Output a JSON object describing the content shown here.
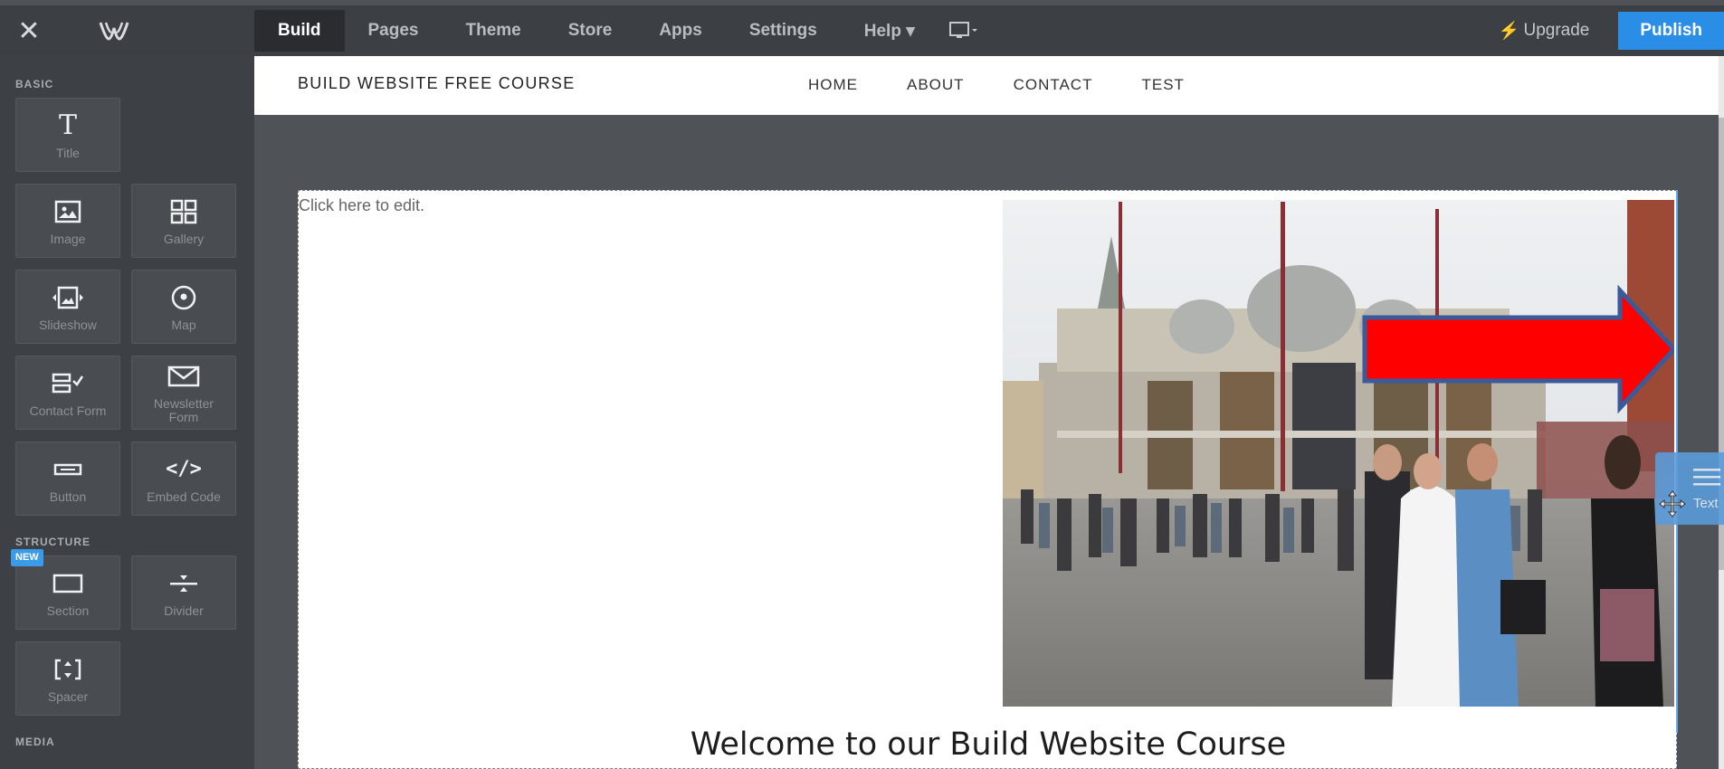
{
  "topbar": {
    "close_icon": "close-icon",
    "logo": "weebly-logo",
    "nav": [
      {
        "label": "Build",
        "active": true
      },
      {
        "label": "Pages"
      },
      {
        "label": "Theme"
      },
      {
        "label": "Store"
      },
      {
        "label": "Apps"
      },
      {
        "label": "Settings"
      },
      {
        "label": "Help ▾"
      }
    ],
    "device_icon": "desktop-icon",
    "upgrade_label": "Upgrade",
    "publish_label": "Publish"
  },
  "sidebar": {
    "basic_label": "BASIC",
    "structure_label": "STRUCTURE",
    "media_label": "MEDIA",
    "new_badge": "NEW",
    "basic_tiles": [
      {
        "label": "Title",
        "icon": "title-icon"
      },
      {
        "label": "Image",
        "icon": "image-icon"
      },
      {
        "label": "Gallery",
        "icon": "gallery-icon"
      },
      {
        "label": "Slideshow",
        "icon": "slideshow-icon"
      },
      {
        "label": "Map",
        "icon": "map-pin-icon"
      },
      {
        "label": "Contact Form",
        "icon": "contact-form-icon"
      },
      {
        "label": "Newsletter Form",
        "icon": "envelope-icon"
      },
      {
        "label": "Button",
        "icon": "button-icon"
      },
      {
        "label": "Embed Code",
        "icon": "code-icon"
      }
    ],
    "structure_tiles": [
      {
        "label": "Section",
        "icon": "section-icon"
      },
      {
        "label": "Divider",
        "icon": "divider-icon"
      },
      {
        "label": "Spacer",
        "icon": "spacer-icon"
      }
    ]
  },
  "site": {
    "title": "BUILD WEBSITE FREE COURSE",
    "nav": [
      "HOME",
      "ABOUT",
      "CONTACT",
      "TEST"
    ],
    "click_to_edit": "Click here to edit.",
    "welcome_heading": "Welcome to our Build Website Course",
    "drop_tab_label": "Text"
  },
  "colors": {
    "accent": "#2b8ee6",
    "arrow": "#ff0000",
    "arrow_outline": "#3a5a9a"
  }
}
